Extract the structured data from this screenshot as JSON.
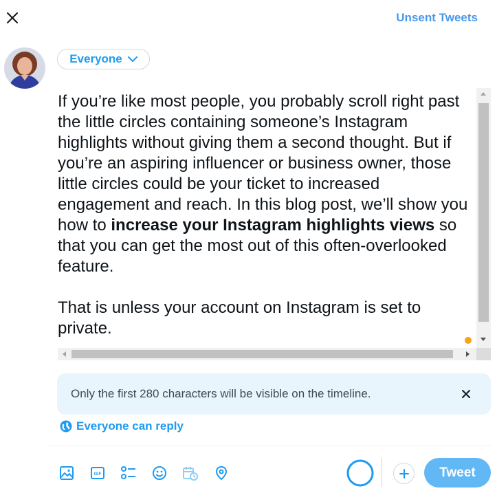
{
  "header": {
    "close_icon": "close-icon",
    "unsent_label": "Unsent Tweets"
  },
  "composer": {
    "audience_label": "Everyone",
    "audience_icon": "chevron-down-icon",
    "text": {
      "p1_before_bold": "If you’re like most people, you probably scroll right past the little circles containing someone’s Instagram highlights without giving them a second thought. But if you’re an aspiring influencer or business owner, those little circles could be your ticket to increased engagement and reach. In this blog post, we’ll show you how to ",
      "p1_bold": "increase your Instagram highlights views",
      "p1_after_bold": " so that you can get the most out of this often-overlooked feature.",
      "p2": "That is unless your account on Instagram is set to private."
    }
  },
  "notice": {
    "text": "Only the first 280 characters will be visible on the timeline.",
    "close_icon": "close-icon"
  },
  "reply": {
    "icon": "globe-icon",
    "label": "Everyone can reply"
  },
  "toolbar": {
    "tools": [
      "image-icon",
      "gif-icon",
      "poll-icon",
      "emoji-icon",
      "schedule-icon",
      "location-icon"
    ],
    "gif_label": "GIF",
    "tweet_label": "Tweet",
    "add_icon": "plus-icon"
  },
  "colors": {
    "accent": "#1d9bf0",
    "tweet_button": "#62b7f5",
    "notice_bg": "#e8f5fd"
  }
}
